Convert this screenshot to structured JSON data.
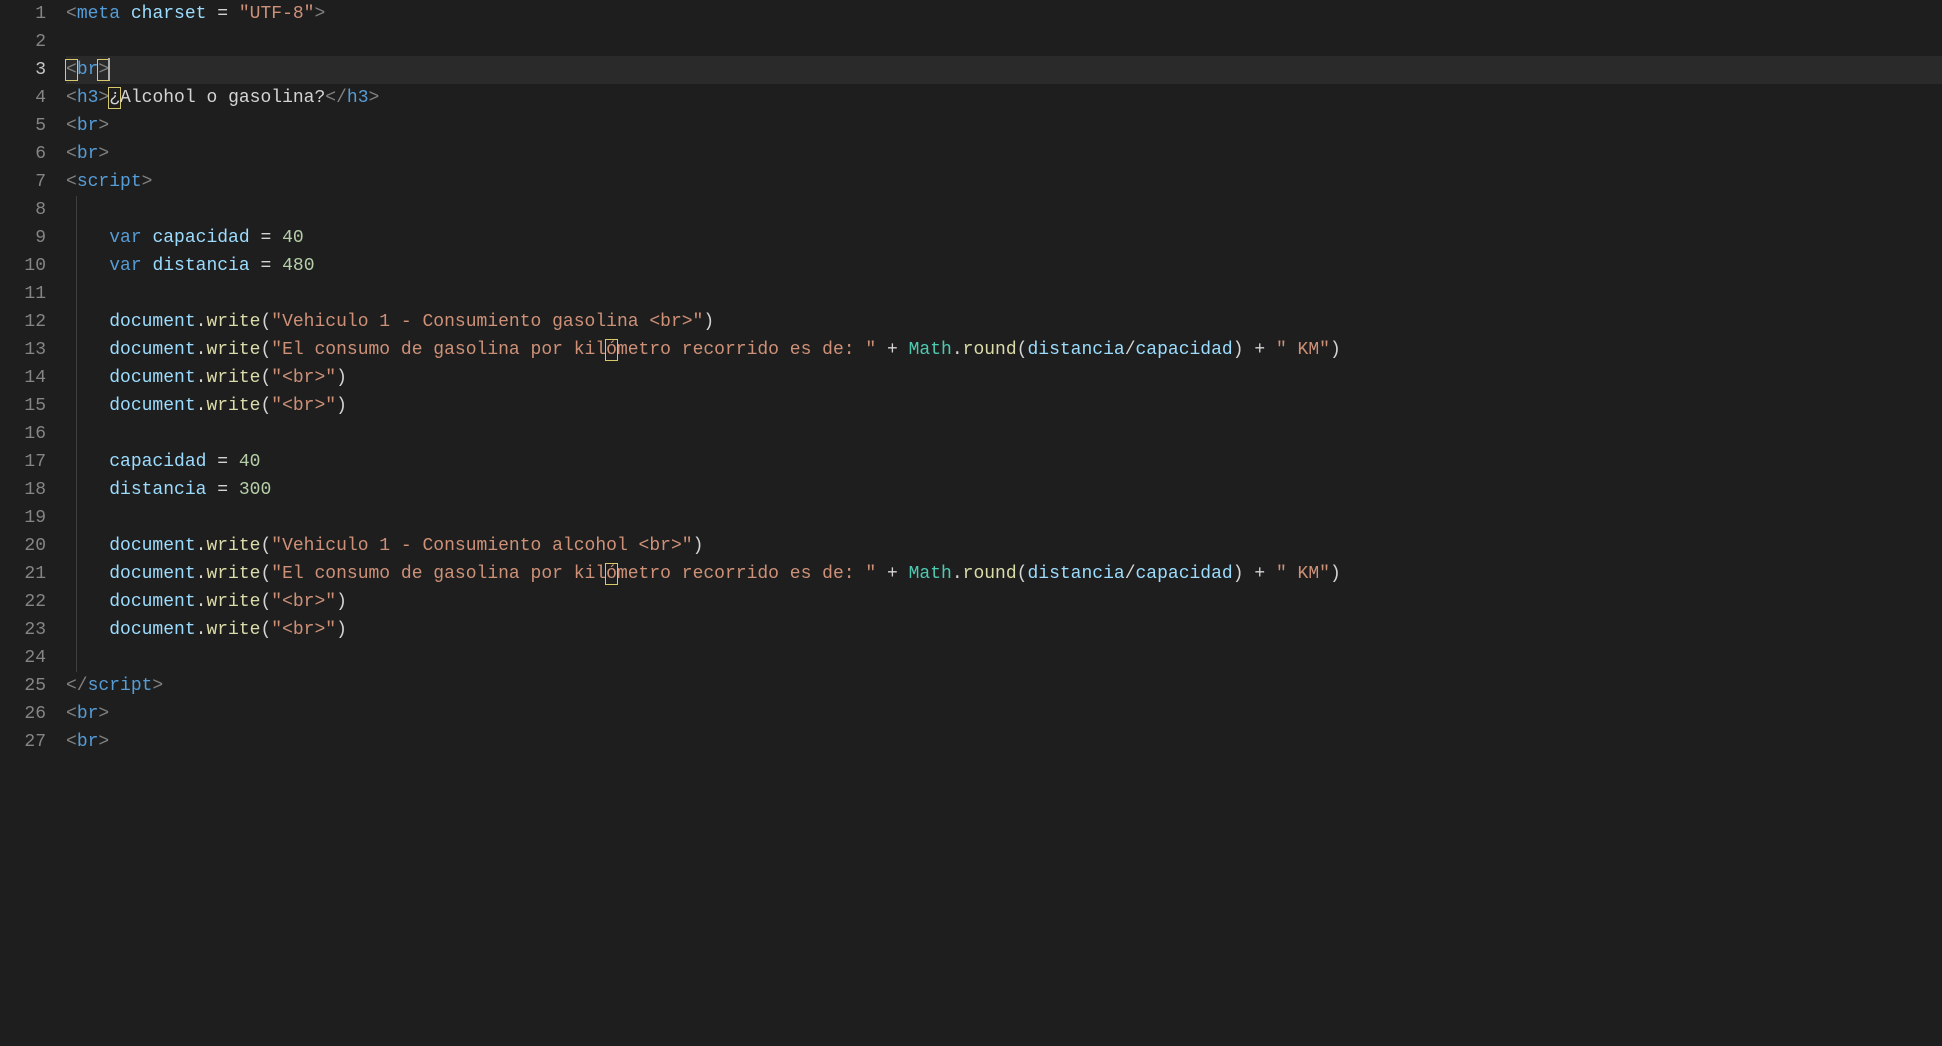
{
  "lineNumbers": [
    "1",
    "2",
    "3",
    "4",
    "5",
    "6",
    "7",
    "8",
    "9",
    "10",
    "11",
    "12",
    "13",
    "14",
    "15",
    "16",
    "17",
    "18",
    "19",
    "20",
    "21",
    "22",
    "23",
    "24",
    "25",
    "26",
    "27"
  ],
  "activeLine": "3",
  "code": {
    "l1": {
      "tag": "meta",
      "attr": "charset",
      "eq": " = ",
      "val": "\"UTF-8\""
    },
    "l3": {
      "open": "<",
      "tag": "br",
      "close": ">"
    },
    "l4": {
      "tag": "h3",
      "qmark": "¿",
      "text": "Alcohol o gasolina?"
    },
    "l5": {
      "tag": "br"
    },
    "l6": {
      "tag": "br"
    },
    "l7": {
      "tag": "script"
    },
    "l9": {
      "kw": "var",
      "name": "capacidad",
      "val": "40"
    },
    "l10": {
      "kw": "var",
      "name": "distancia",
      "val": "480"
    },
    "l12": {
      "obj": "document",
      "fn": "write",
      "str": "\"Vehiculo 1 - Consumiento gasolina <br>\""
    },
    "l13": {
      "obj": "document",
      "fn": "write",
      "str1": "\"El consumo de gasolina por kil",
      "o": "ó",
      "str1b": "metro recorrido es de: \"",
      "plus": " + ",
      "glob": "Math",
      "fn2": "round",
      "arg1": "distancia",
      "slash": "/",
      "arg2": "capacidad",
      "plus2": " + ",
      "str2": "\" KM\""
    },
    "l14": {
      "obj": "document",
      "fn": "write",
      "str": "\"<br>\""
    },
    "l15": {
      "obj": "document",
      "fn": "write",
      "str": "\"<br>\""
    },
    "l17": {
      "name": "capacidad",
      "val": "40"
    },
    "l18": {
      "name": "distancia",
      "val": "300"
    },
    "l20": {
      "obj": "document",
      "fn": "write",
      "str": "\"Vehiculo 1 - Consumiento alcohol <br>\""
    },
    "l21": {
      "obj": "document",
      "fn": "write",
      "str1": "\"El consumo de gasolina por kil",
      "o": "ó",
      "str1b": "metro recorrido es de: \"",
      "plus": " + ",
      "glob": "Math",
      "fn2": "round",
      "arg1": "distancia",
      "slash": "/",
      "arg2": "capacidad",
      "plus2": " + ",
      "str2": "\" KM\""
    },
    "l22": {
      "obj": "document",
      "fn": "write",
      "str": "\"<br>\""
    },
    "l23": {
      "obj": "document",
      "fn": "write",
      "str": "\"<br>\""
    },
    "l25": {
      "tag": "script"
    },
    "l26": {
      "tag": "br"
    },
    "l27": {
      "tag": "br"
    }
  }
}
